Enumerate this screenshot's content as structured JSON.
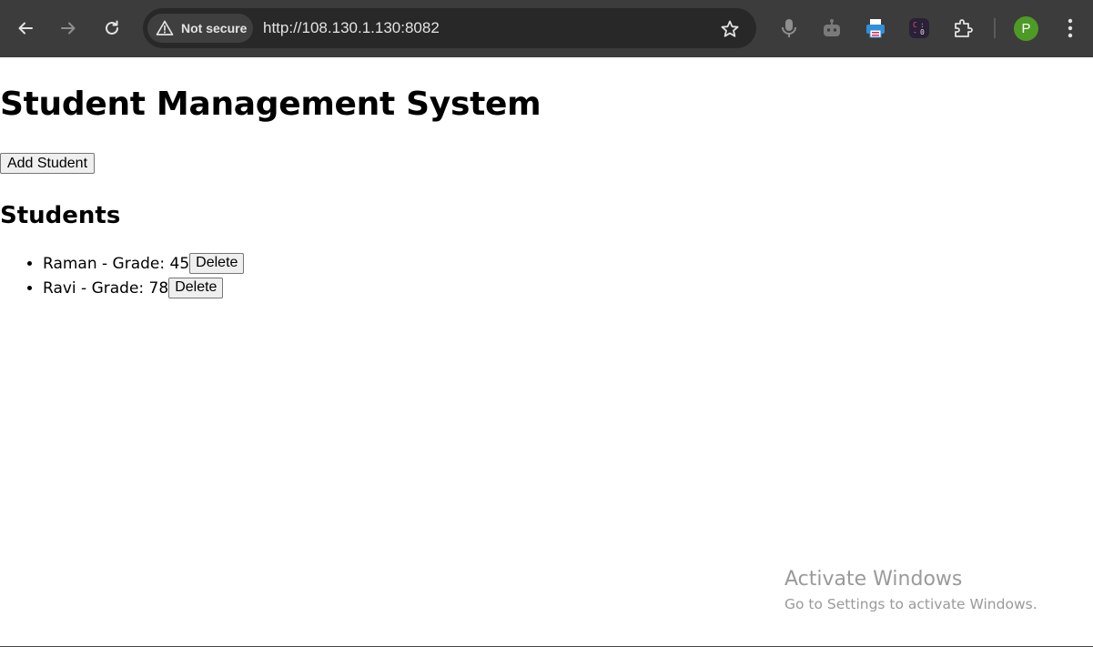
{
  "browser": {
    "security_label": "Not secure",
    "url": "http://108.130.1.130:8082",
    "profile_initial": "P",
    "icons": {
      "back": "arrow-left-icon",
      "forward": "arrow-right-icon",
      "reload": "reload-icon",
      "bookmark": "star-icon",
      "mic": "microphone-icon",
      "assistant": "robot-icon",
      "extension1": "printer-extension-icon",
      "extension2": "code-extension-icon",
      "extensions": "puzzle-icon",
      "menu": "kebab-menu-icon"
    }
  },
  "page": {
    "title": "Student Management System",
    "add_button": "Add Student",
    "section_title": "Students",
    "students": [
      {
        "text": "Raman - Grade: 45",
        "delete_label": "Delete"
      },
      {
        "text": "Ravi - Grade: 78",
        "delete_label": "Delete"
      }
    ]
  },
  "watermark": {
    "title": "Activate Windows",
    "subtitle": "Go to Settings to activate Windows."
  }
}
